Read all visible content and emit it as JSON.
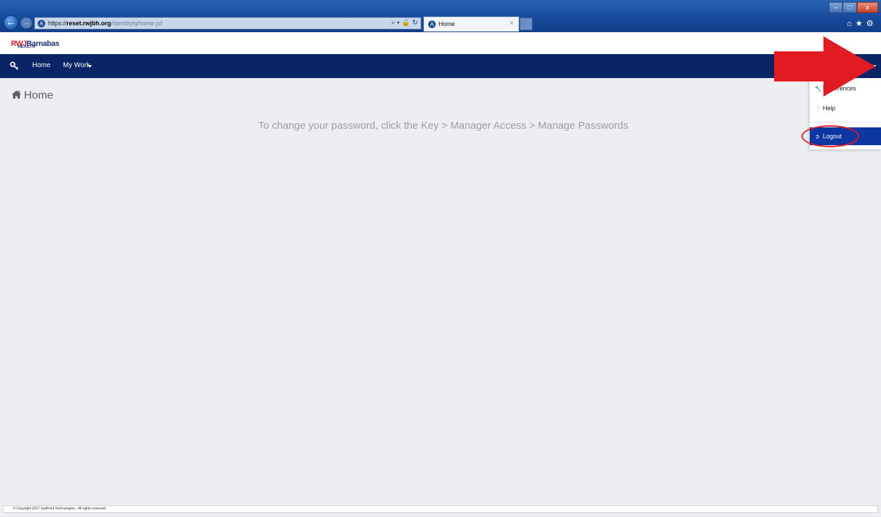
{
  "browser": {
    "address": {
      "protocol": "https://",
      "host": "reset.rwjbh.org",
      "path": "/identityiq/home.jsf"
    },
    "address_tools": "⌕ ▾ 🔒 ↻",
    "tab_title": "Home",
    "tab_close": "×",
    "win_min": "–",
    "win_max": "□",
    "win_close": "x",
    "fav_tools": "⌂★⚙"
  },
  "logo": {
    "rwj": "RWJ",
    "barnabas": "Barnabas",
    "health": "HEALTH"
  },
  "nav": {
    "home": "Home",
    "my_work": "My Work"
  },
  "page": {
    "title": "Home",
    "instructions": "To change your password, click the Key > Manager Access > Manage Passwords"
  },
  "user_menu": {
    "items": [
      {
        "label": "Preferences",
        "icon": "wrench-icon"
      },
      {
        "label": "Help",
        "icon": "question-circle-icon"
      },
      {
        "label": "Logout",
        "icon": "sign-out-icon"
      }
    ]
  },
  "annotations": {
    "arrow_color": "#e21b23",
    "ellipse_color": "#e21b23"
  },
  "footer": {
    "copyright": "© Copyright 2017 SailPoint Technologies - All rights reserved."
  }
}
